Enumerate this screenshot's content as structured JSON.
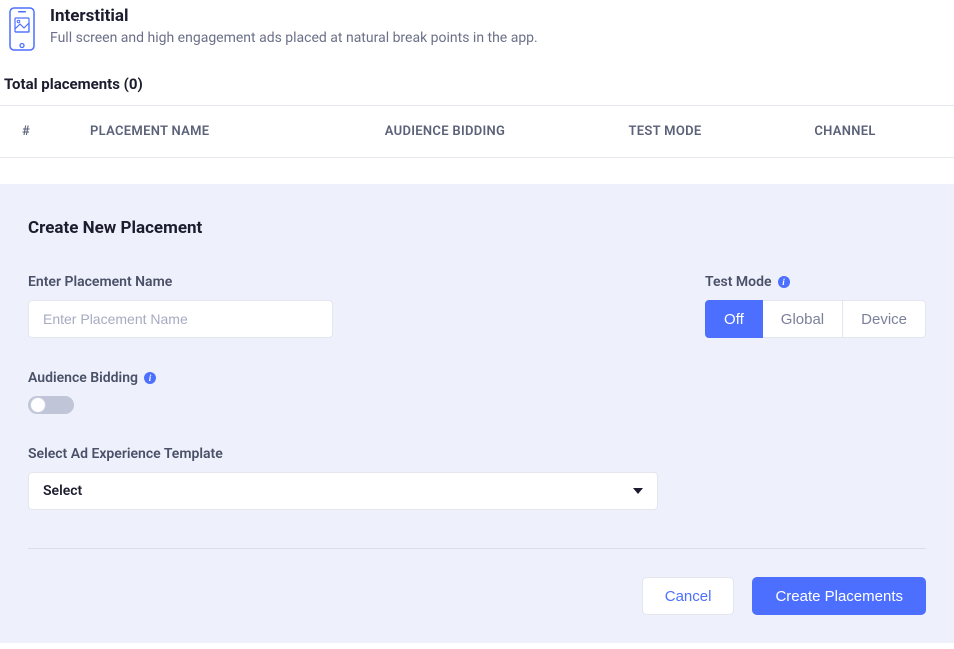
{
  "header": {
    "title": "Interstitial",
    "subtitle": "Full screen and high engagement ads placed at natural break points in the app."
  },
  "total_placements_label": "Total placements (0)",
  "table": {
    "columns": {
      "num": "#",
      "name": "PLACEMENT NAME",
      "audience": "AUDIENCE BIDDING",
      "test": "TEST MODE",
      "channel": "CHANNEL"
    }
  },
  "form": {
    "title": "Create New Placement",
    "name_label": "Enter Placement Name",
    "name_placeholder": "Enter Placement Name",
    "test_mode_label": "Test Mode",
    "test_mode_options": {
      "off": "Off",
      "global": "Global",
      "device": "Device"
    },
    "audience_label": "Audience Bidding",
    "template_label": "Select Ad Experience Template",
    "template_value": "Select",
    "cancel_label": "Cancel",
    "submit_label": "Create Placements",
    "info_glyph": "i"
  }
}
